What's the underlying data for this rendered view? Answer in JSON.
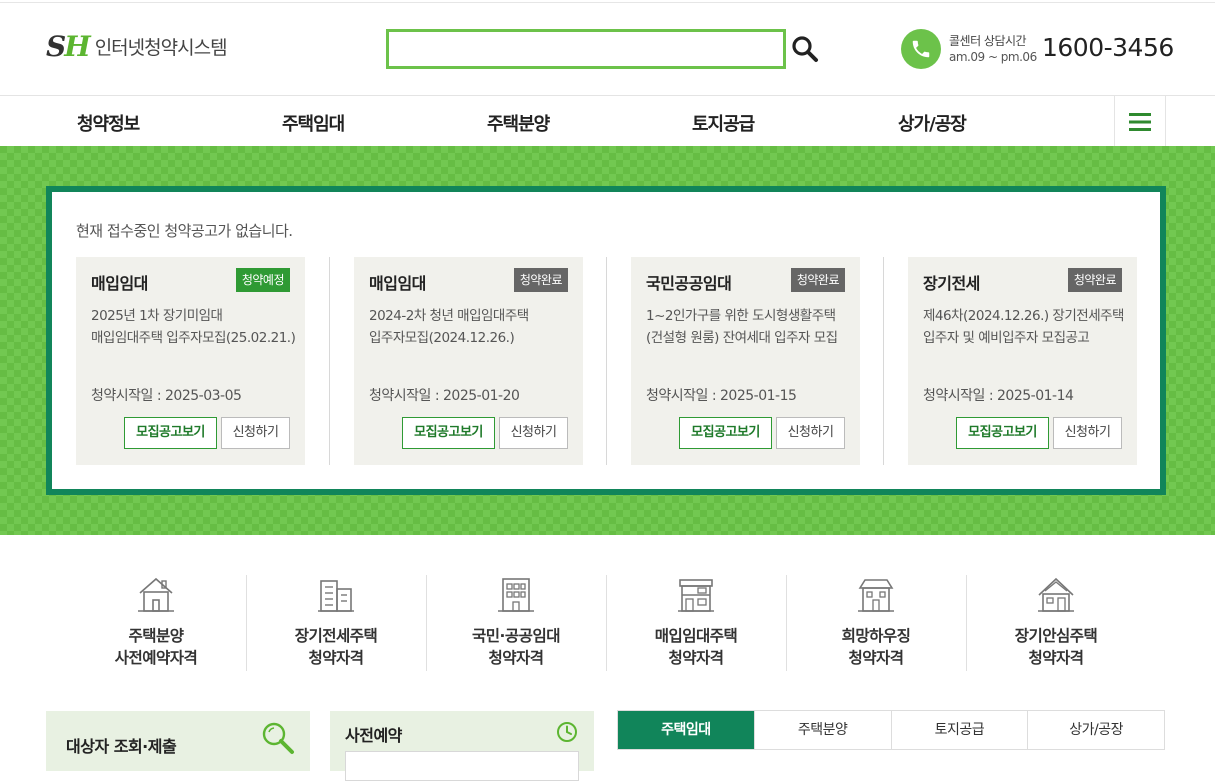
{
  "header": {
    "logo_mark_s": "S",
    "logo_mark_h": "H",
    "logo_text": "인터넷청약시스템",
    "search": {
      "value": "",
      "placeholder": ""
    },
    "call_center": {
      "label": "콜센터 상담시간",
      "hours": "am.09 ~ pm.06",
      "number": "1600-3456"
    }
  },
  "nav": {
    "items": [
      "청약정보",
      "주택임대",
      "주택분양",
      "토지공급",
      "상가/공장"
    ]
  },
  "notice": {
    "message": "현재 접수중인 청약공고가 없습니다.",
    "cards": [
      {
        "category": "매입임대",
        "badge": "청약예정",
        "badge_color": "#2f9a34",
        "title": "2025년 1차 장기미임대 매입임대주택 입주자모집(25.02.21.)",
        "date": "청약시작일 : 2025-03-05",
        "view_label": "모집공고보기",
        "apply_label": "신청하기"
      },
      {
        "category": "매입임대",
        "badge": "청약완료",
        "badge_color": "#666666",
        "title": "2024-2차 청년 매입임대주택 입주자모집(2024.12.26.)",
        "date": "청약시작일 : 2025-01-20",
        "view_label": "모집공고보기",
        "apply_label": "신청하기"
      },
      {
        "category": "국민공공임대",
        "badge": "청약완료",
        "badge_color": "#666666",
        "title": "1~2인가구를 위한 도시형생활주택(건설형 원룸) 잔여세대 입주자 모집",
        "date": "청약시작일 : 2025-01-15",
        "view_label": "모집공고보기",
        "apply_label": "신청하기"
      },
      {
        "category": "장기전세",
        "badge": "청약완료",
        "badge_color": "#666666",
        "title": "제46차(2024.12.26.) 장기전세주택 입주자 및 예비입주자 모집공고",
        "date": "청약시작일 : 2025-01-14",
        "view_label": "모집공고보기",
        "apply_label": "신청하기"
      }
    ]
  },
  "qualifications": [
    {
      "line1": "주택분양",
      "line2": "사전예약자격",
      "icon": "house-icon"
    },
    {
      "line1": "장기전세주택",
      "line2": "청약자격",
      "icon": "apartment-icon"
    },
    {
      "line1": "국민·공공임대",
      "line2": "청약자격",
      "icon": "building-icon"
    },
    {
      "line1": "매입임대주택",
      "line2": "청약자격",
      "icon": "townhouse-icon"
    },
    {
      "line1": "희망하우징",
      "line2": "청약자격",
      "icon": "dormitory-icon"
    },
    {
      "line1": "장기안심주택",
      "line2": "청약자격",
      "icon": "safe-house-icon"
    }
  ],
  "bottom": {
    "target_panel_title": "대상자 조회·제출",
    "prebook_panel_title": "사전예약",
    "tabs": [
      "주택임대",
      "주택분양",
      "토지공급",
      "상가/공장"
    ],
    "active_tab": "주택임대"
  },
  "colors": {
    "brand_green": "#6cc24a",
    "dark_green": "#11855a"
  }
}
